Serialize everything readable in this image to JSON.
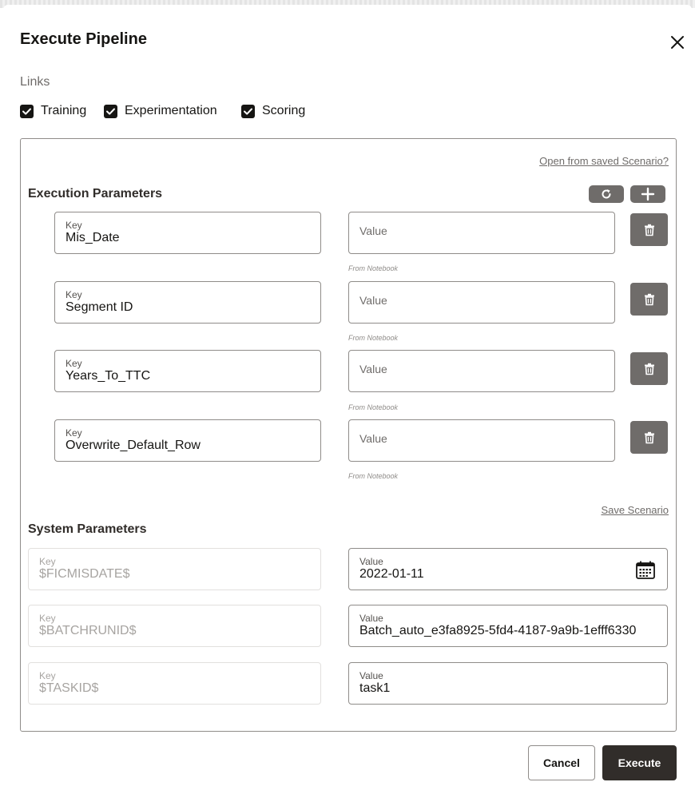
{
  "dialog": {
    "title": "Execute Pipeline",
    "close_icon": "close-icon"
  },
  "links": {
    "label": "Links",
    "items": [
      {
        "label": "Training",
        "checked": true
      },
      {
        "label": "Experimentation",
        "checked": true
      },
      {
        "label": "Scoring",
        "checked": true
      }
    ]
  },
  "panel": {
    "open_saved_link": "Open from saved Scenario?",
    "execution_title": "Execution Parameters",
    "refresh_icon": "refresh-icon",
    "add_icon": "plus-icon",
    "delete_icon": "trash-icon",
    "params": [
      {
        "key_label": "Key",
        "key": "Mis_Date",
        "value_placeholder": "Value",
        "hint": "From Notebook"
      },
      {
        "key_label": "Key",
        "key": "Segment ID",
        "value_placeholder": "Value",
        "hint": "From Notebook"
      },
      {
        "key_label": "Key",
        "key": "Years_To_TTC",
        "value_placeholder": "Value",
        "hint": "From Notebook"
      },
      {
        "key_label": "Key",
        "key": "Overwrite_Default_Row",
        "value_placeholder": "Value",
        "hint": "From Notebook"
      }
    ],
    "save_scenario_link": "Save Scenario",
    "system_title": "System Parameters",
    "calendar_icon": "calendar-icon",
    "system_params": [
      {
        "key_label": "Key",
        "key": "$FICMISDATE$",
        "value_label": "Value",
        "value": "2022-01-11"
      },
      {
        "key_label": "Key",
        "key": "$BATCHRUNID$",
        "value_label": "Value",
        "value": "Batch_auto_e3fa8925-5fd4-4187-9a9b-1efff6330"
      },
      {
        "key_label": "Key",
        "key": "$TASKID$",
        "value_label": "Value",
        "value": "task1"
      }
    ]
  },
  "footer": {
    "cancel_label": "Cancel",
    "execute_label": "Execute"
  },
  "colors": {
    "primary": "#312d2a",
    "secondary_button": "#6f6c6a",
    "border": "#8f8c89"
  }
}
